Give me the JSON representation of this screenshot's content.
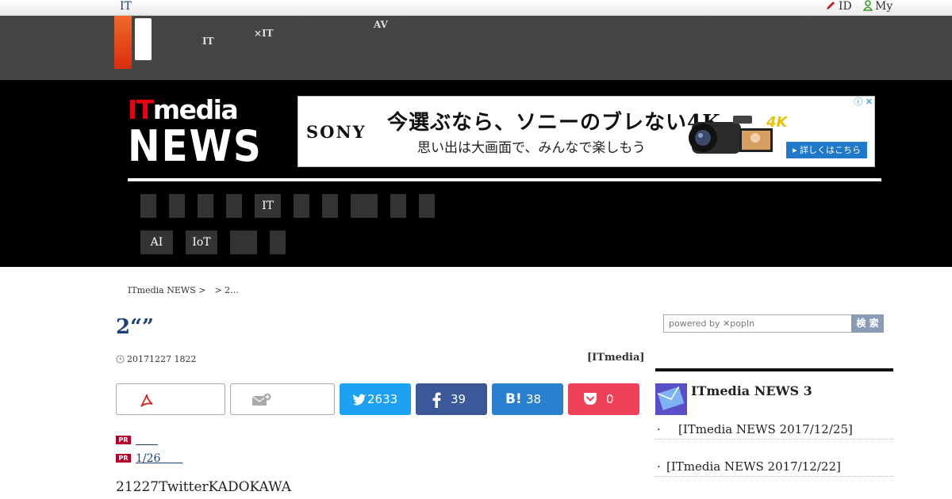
{
  "topbar": {
    "it_link": "IT",
    "id_link": "ID",
    "my_link": "My"
  },
  "groupnav": {
    "items": [
      {
        "line1": "　　",
        "line2": "IT"
      },
      {
        "line1": "　　　",
        "line2": "×IT"
      },
      {
        "line1": "AV",
        "line2": "　　"
      }
    ]
  },
  "header": {
    "logo_it": "IT",
    "logo_media": "media",
    "logo_news": "NEWS"
  },
  "ad": {
    "brand": "SONY",
    "headline": "今選ぶなら、ソニーのブレない4K",
    "sub": "思い出は大画面で、みんなで楽しもう",
    "badge": "4K",
    "more": "▸ 詳しくはこちら",
    "adchoice": "ⓘ ✕"
  },
  "catnav": {
    "row1": [
      "",
      "",
      "",
      "",
      "IT",
      "",
      "",
      "",
      "",
      ""
    ],
    "row2": [
      "AI",
      "IoT",
      "",
      ""
    ]
  },
  "breadcrumb": "ITmedia NEWS >　> 2...",
  "article": {
    "title": "2“”",
    "date": "20171227 1822",
    "byline": "[ITmedia]",
    "pr1": "　　",
    "pr2": "1/26　　",
    "pr_tag": "PR",
    "lead": "21227TwitterKADOKAWA"
  },
  "share": {
    "twitter": "2633",
    "facebook": "39",
    "hatena": "38",
    "pocket": "0",
    "hatena_label": "B!"
  },
  "sidebar": {
    "search_placeholder": "powered by ✕popIn",
    "search_button": "検 索",
    "section_title": "ITmedia NEWS 3",
    "items": [
      {
        "text": "　[ITmedia NEWS 2017/12/25]"
      },
      {
        "text": "[ITmedia NEWS 2017/12/22]"
      }
    ]
  },
  "colors": {
    "accent": "#e60012",
    "link": "#1b3f7a",
    "twitter": "#1da1f2",
    "facebook": "#3b5998",
    "hatena": "#2a80d0",
    "pocket": "#ee4056"
  }
}
